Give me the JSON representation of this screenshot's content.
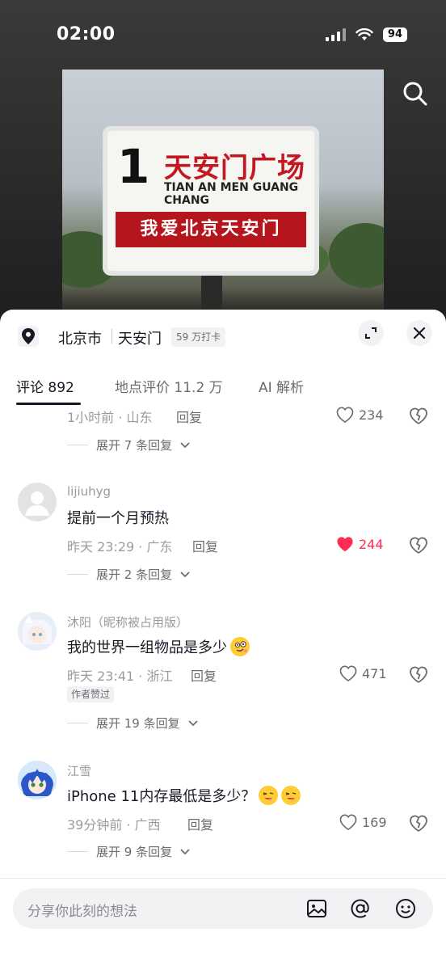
{
  "status_bar": {
    "time": "02:00",
    "battery": "94"
  },
  "photo": {
    "sign_number": "1",
    "sign_title_cn": "天安门广场",
    "sign_title_en": "TIAN AN MEN GUANG CHANG",
    "sign_slogan": "我爱北京天安门"
  },
  "location": {
    "city": "北京市",
    "place": "天安门",
    "badge": "59 万打卡"
  },
  "tabs": [
    {
      "label": "评论 892"
    },
    {
      "label": "地点评价 11.2 万"
    },
    {
      "label": "AI 解析"
    }
  ],
  "comments": [
    {
      "meta": "1小时前 · 山东",
      "reply": "回复",
      "likes": "234",
      "expand": "展开 7 条回复"
    },
    {
      "username": "lijiuhyg",
      "text": "提前一个月预热",
      "meta": "昨天 23:29 · 广东",
      "reply": "回复",
      "likes": "244",
      "expand": "展开 2 条回复"
    },
    {
      "username": "沐阳（昵称被占用版）",
      "text": "我的世界一组物品是多少",
      "meta": "昨天 23:41 · 浙江",
      "reply": "回复",
      "likes": "471",
      "tag": "作者赞过",
      "expand": "展开 19 条回复"
    },
    {
      "username": "江雪",
      "text": "iPhone 11内存最低是多少？",
      "meta": "39分钟前 · 广西",
      "reply": "回复",
      "likes": "169",
      "expand": "展开 9 条回复"
    }
  ],
  "input": {
    "placeholder": "分享你此刻的想法"
  },
  "colors": {
    "like_active": "#fe2c55",
    "text_primary": "#161823",
    "text_secondary": "#9a9ba0"
  },
  "icons": [
    "search-icon",
    "location-pin-icon",
    "expand-icon",
    "close-icon",
    "heart-icon",
    "dislike-icon",
    "chevron-down-icon",
    "image-icon",
    "at-icon",
    "emoji-icon"
  ]
}
